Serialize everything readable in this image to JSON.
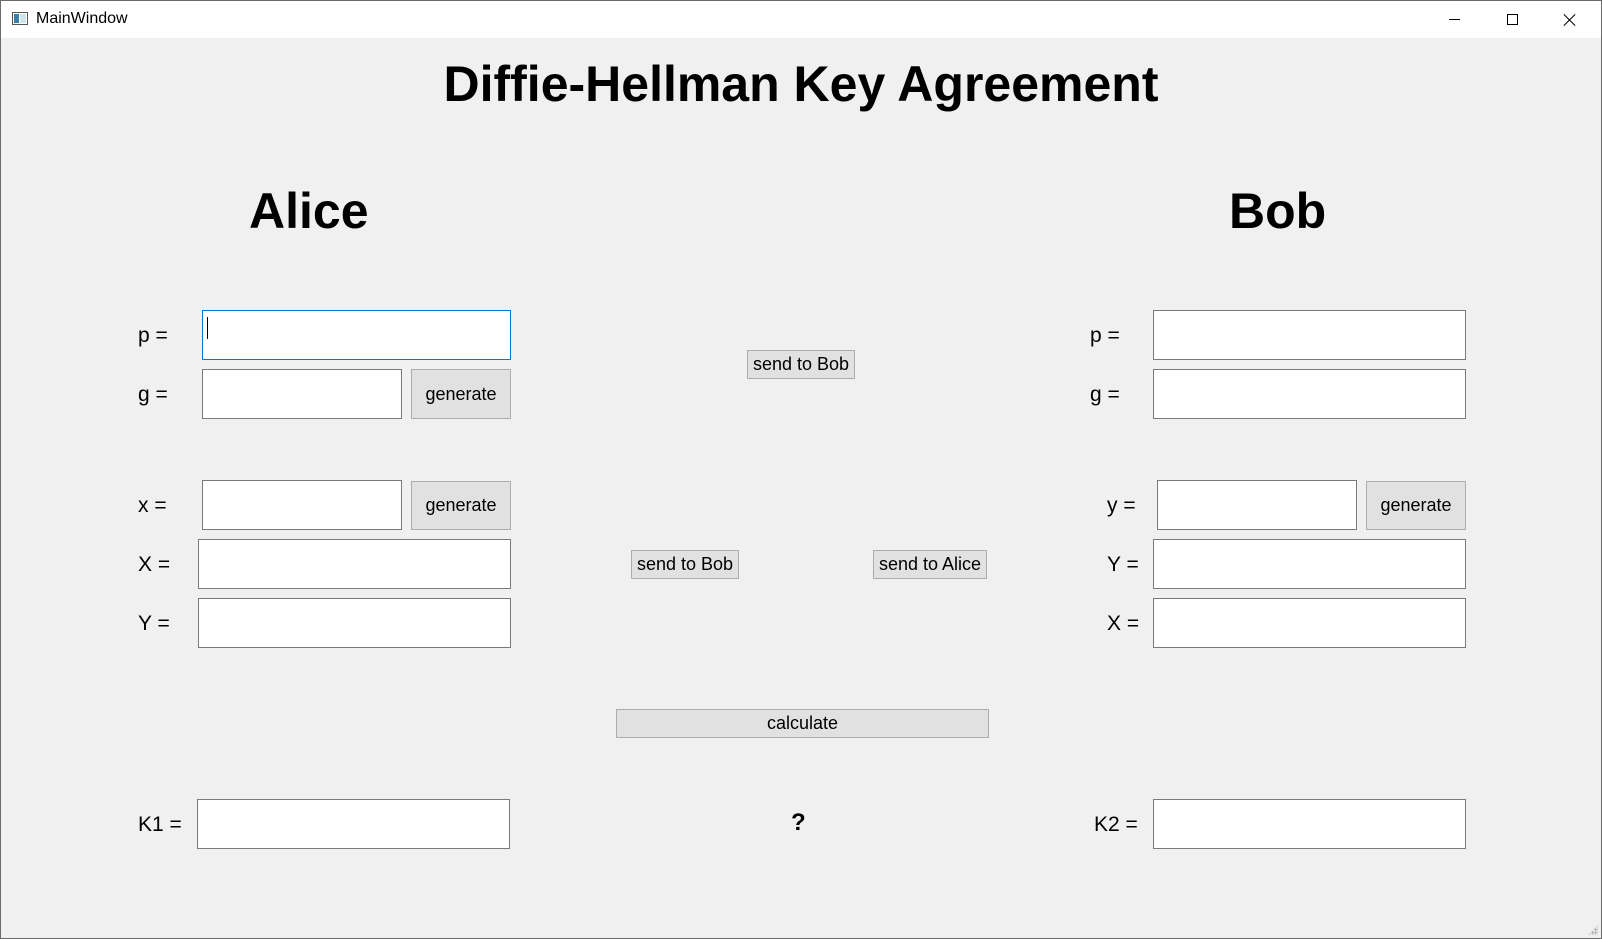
{
  "window": {
    "title": "MainWindow",
    "controls": {
      "minimize": "minimize-icon",
      "maximize": "maximize-icon",
      "close": "close-icon"
    }
  },
  "main_title": "Diffie-Hellman Key Agreement",
  "alice": {
    "title": "Alice",
    "p_label": "p =",
    "g_label": "g =",
    "x_label": "x =",
    "X_label": "X =",
    "Y_label": "Y =",
    "k1_label": "K1 =",
    "p_value": "",
    "g_value": "",
    "x_value": "",
    "X_value": "",
    "Y_value": "",
    "k1_value": "",
    "generate_g_label": "generate",
    "generate_x_label": "generate"
  },
  "bob": {
    "title": "Bob",
    "p_label": "p =",
    "g_label": "g =",
    "y_label": "y =",
    "Y_label": "Y =",
    "X_label": "X =",
    "k2_label": "K2 =",
    "p_value": "",
    "g_value": "",
    "y_value": "",
    "Y_value": "",
    "X_value": "",
    "k2_value": "",
    "generate_y_label": "generate"
  },
  "center": {
    "send_pg_to_bob_label": "send to Bob",
    "send_X_to_bob_label": "send to Bob",
    "send_Y_to_alice_label": "send to Alice",
    "calculate_label": "calculate",
    "compare_symbol": "?"
  }
}
